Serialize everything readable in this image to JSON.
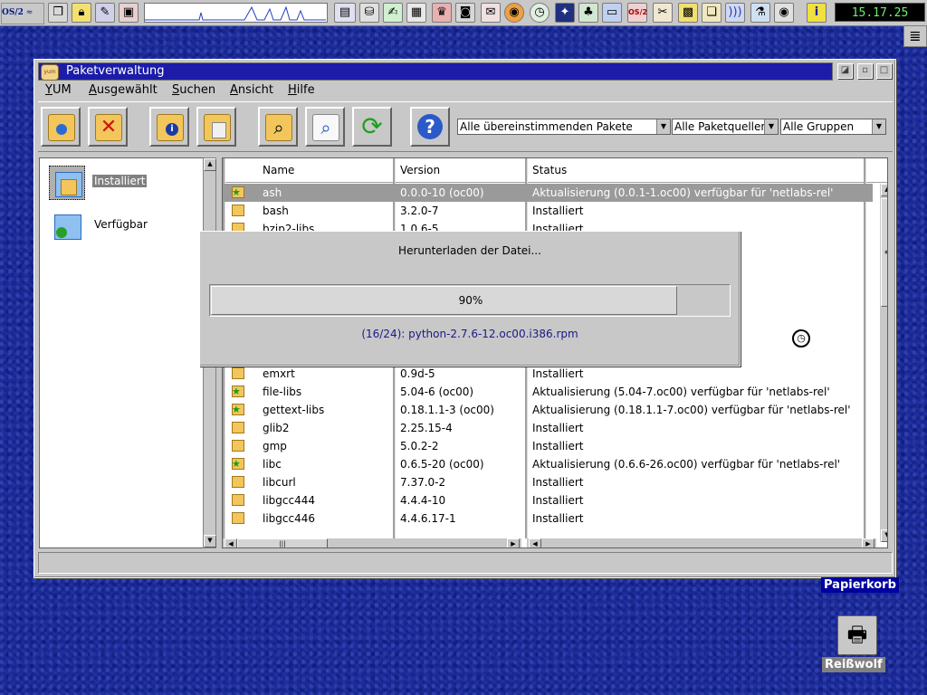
{
  "taskbar": {
    "logo_text": "OS/2",
    "clock": "15.17.25",
    "icons": [
      "windows-list-icon",
      "lock-icon",
      "screwdriver-icon",
      "monitor-icon",
      "network-icon",
      "drive-icon",
      "editor-icon",
      "calculator-icon",
      "shield-icon",
      "camera-icon",
      "app-icon",
      "firefox-icon",
      "clock-app-icon",
      "photo-icon",
      "tree-icon",
      "computer-icon",
      "warp-icon",
      "palette-icon",
      "folder-icon",
      "doc-icon",
      "sound-icon",
      "tool-icon",
      "eye-icon",
      "info-icon"
    ]
  },
  "window": {
    "title": "Paketverwaltung",
    "app_icon_text": "yum"
  },
  "menu": [
    {
      "label": "YUM"
    },
    {
      "label": "Ausgewählt"
    },
    {
      "label": "Suchen"
    },
    {
      "label": "Ansicht"
    },
    {
      "label": "Hilfe"
    }
  ],
  "filters": {
    "packages": "Alle übereinstimmenden Pakete",
    "sources": "Alle Paketquellen",
    "groups": "Alle Gruppen"
  },
  "categories": [
    {
      "label": "Installiert"
    },
    {
      "label": "Verfügbar"
    }
  ],
  "table": {
    "headers": [
      "Name",
      "Version",
      "Status"
    ],
    "rows": [
      {
        "name": "ash",
        "version": "0.0.0-10 (oc00)",
        "status": "Aktualisierung (0.0.1-1.oc00) verfügbar für 'netlabs-rel'"
      },
      {
        "name": "bash",
        "version": "3.2.0-7",
        "status": "Installiert"
      },
      {
        "name": "bzip2-libs",
        "version": "1.0.6-5",
        "status": "Installiert"
      },
      {
        "name": "emxrt",
        "version": "0.9d-5",
        "status": "Installiert"
      },
      {
        "name": "file-libs",
        "version": "5.04-6 (oc00)",
        "status": "Aktualisierung (5.04-7.oc00) verfügbar für 'netlabs-rel'"
      },
      {
        "name": "gettext-libs",
        "version": "0.18.1.1-3 (oc00)",
        "status": "Aktualisierung (0.18.1.1-7.oc00) verfügbar für 'netlabs-rel'"
      },
      {
        "name": "glib2",
        "version": "2.25.15-4",
        "status": "Installiert"
      },
      {
        "name": "gmp",
        "version": "5.0.2-2",
        "status": "Installiert"
      },
      {
        "name": "libc",
        "version": "0.6.5-20 (oc00)",
        "status": "Aktualisierung (0.6.6-26.oc00) verfügbar für 'netlabs-rel'"
      },
      {
        "name": "libcurl",
        "version": "7.37.0-2",
        "status": "Installiert"
      },
      {
        "name": "libgcc444",
        "version": "4.4.4-10",
        "status": "Installiert"
      },
      {
        "name": "libgcc446",
        "version": "4.4.6.17-1",
        "status": "Installiert"
      }
    ]
  },
  "dialog": {
    "message": "Herunterladen der Datei...",
    "progress_text": "90%",
    "progress": 0.9,
    "file": "(16/24): python-2.7.6-12.oc00.i386.rpm"
  },
  "desktop": {
    "trash_label": "Papierkorb",
    "shredder_label": "Reißwolf"
  }
}
